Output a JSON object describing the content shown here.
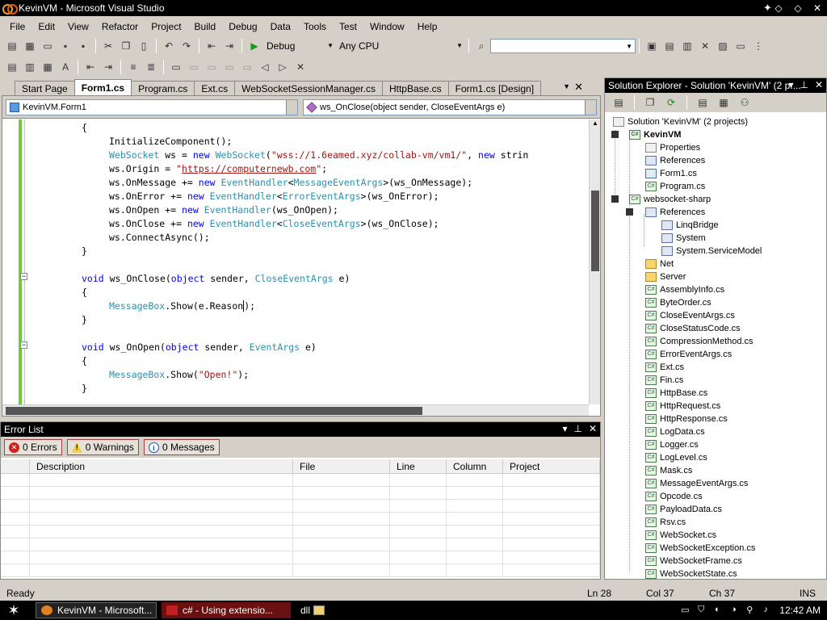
{
  "window": {
    "title": "KevinVM - Microsoft Visual Studio"
  },
  "menu": [
    "File",
    "Edit",
    "View",
    "Refactor",
    "Project",
    "Build",
    "Debug",
    "Data",
    "Tools",
    "Test",
    "Window",
    "Help"
  ],
  "toolbar": {
    "config": "Debug",
    "platform": "Any CPU"
  },
  "tabs": [
    "Start Page",
    "Form1.cs",
    "Program.cs",
    "Ext.cs",
    "WebSocketSessionManager.cs",
    "HttpBase.cs",
    "Form1.cs [Design]"
  ],
  "editor": {
    "type_combo": "KevinVM.Form1",
    "member_combo": "ws_OnClose(object sender, CloseEventArgs e)"
  },
  "code": {
    "l0": "{",
    "l1": "InitializeComponent();",
    "l2_kw_type": "WebSocket",
    "l2_var": " ws = ",
    "l2_new": "new",
    "l2_type2": "WebSocket",
    "l2_str": "\"wss://1.6eamed.xyz/collab-vm/vm1/\"",
    "l2_rest": ", ",
    "l2_new2": "new",
    "l2_tail": " strin",
    "l3_pre": "ws.Origin = ",
    "l3_q1": "\"",
    "l3_url": "https://computernewb.com",
    "l3_q2": "\"",
    "l3_post": ";",
    "l4_pre": "ws.OnMessage += ",
    "l4_type": "EventHandler",
    "l4_gen": "MessageEventArgs",
    "l4_post": "(ws_OnMessage);",
    "l5_pre": "ws.OnError += ",
    "l5_type": "EventHandler",
    "l5_gen": "ErrorEventArgs",
    "l5_post": "(ws_OnError);",
    "l6_pre": "ws.OnOpen += ",
    "l6_type": "EventHandler",
    "l6_post": "(ws_OnOpen);",
    "l7_pre": "ws.OnClose += ",
    "l7_type": "EventHandler",
    "l7_gen": "CloseEventArgs",
    "l7_post": "(ws_OnClose);",
    "l8": "ws.ConnectAsync();",
    "l9": "}",
    "l10_void": "void",
    "l10_name": " ws_OnClose(",
    "l10_obj": "object",
    "l10_mid": " sender, ",
    "l10_type": "CloseEventArgs",
    "l10_post": " e)",
    "l11": "{",
    "l12_type": "MessageBox",
    "l12_a": ".Show(e.Reason",
    "l12_b": ");",
    "l13": "}",
    "l14_void": "void",
    "l14_name": " ws_OnOpen(",
    "l14_obj": "object",
    "l14_mid": " sender, ",
    "l14_type": "EventArgs",
    "l14_post": " e)",
    "l15": "{",
    "l16_type": "MessageBox",
    "l16_a": ".Show(",
    "l16_str": "\"Open!\"",
    "l16_b": ");",
    "l17": "}",
    "new_kw": "new"
  },
  "error_list": {
    "title": "Error List",
    "errors": "0 Errors",
    "warnings": "0 Warnings",
    "messages": "0 Messages",
    "columns": [
      "Description",
      "File",
      "Line",
      "Column",
      "Project"
    ]
  },
  "solution_explorer": {
    "title": "Solution Explorer - Solution 'KevinVM' (2 pr...",
    "items": [
      "Solution 'KevinVM' (2 projects)",
      "KevinVM",
      "Properties",
      "References",
      "Form1.cs",
      "Program.cs",
      "websocket-sharp",
      "References",
      "LinqBridge",
      "System",
      "System.ServiceModel",
      "Net",
      "Server",
      "AssemblyInfo.cs",
      "ByteOrder.cs",
      "CloseEventArgs.cs",
      "CloseStatusCode.cs",
      "CompressionMethod.cs",
      "ErrorEventArgs.cs",
      "Ext.cs",
      "Fin.cs",
      "HttpBase.cs",
      "HttpRequest.cs",
      "HttpResponse.cs",
      "LogData.cs",
      "Logger.cs",
      "LogLevel.cs",
      "Mask.cs",
      "MessageEventArgs.cs",
      "Opcode.cs",
      "PayloadData.cs",
      "Rsv.cs",
      "WebSocket.cs",
      "WebSocketException.cs",
      "WebSocketFrame.cs",
      "WebSocketState.cs"
    ]
  },
  "status": {
    "ready": "Ready",
    "line": "Ln 28",
    "col": "Col 37",
    "ch": "Ch 37",
    "mode": "INS"
  },
  "taskbar": {
    "tasks": [
      "KevinVM - Microsoft...",
      "c# - Using extensio...",
      "dll"
    ],
    "clock": "12:42 AM"
  }
}
